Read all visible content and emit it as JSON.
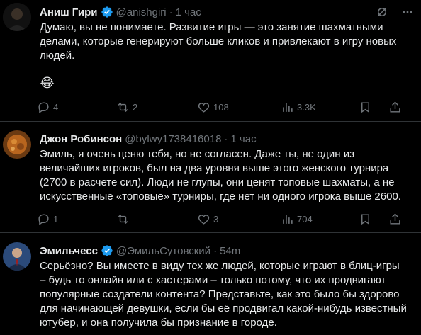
{
  "tweets": [
    {
      "name": "Аниш Гири",
      "handle": "@anishgiri",
      "time": "1 час",
      "text": "Думаю, вы не понимаете. Развитие игры — это занятие шахматными делами, которые генерируют больше кликов и привлекают в игру новых людей.",
      "emoji": "😂",
      "replies": "4",
      "reposts": "2",
      "likes": "108",
      "views": "3.3K"
    },
    {
      "name": "Джон Робинсон",
      "handle": "@bylwy1738416018",
      "time": "1 час",
      "text": "Эмиль, я очень ценю тебя, но не согласен. Даже ты, не один из величайших игроков, был на два уровня выше этого женского турнира (2700 в расчете сил). Люди не глупы, они ценят топовые шахматы, а не искусственные «топовые» турниры, где нет ни одного игрока выше 2600.",
      "replies": "1",
      "reposts": "",
      "likes": "3",
      "views": "704"
    },
    {
      "name": "Эмильчесс",
      "handle": "@ЭмильСутовский",
      "time": "54m",
      "text": "Серьёзно? Вы имеете в виду тех же людей, которые играют в блиц-игры – будь то онлайн или с хастерами – только потому, что их продвигают популярные создатели контента? Представьте, как это было бы здорово для начинающей девушки, если бы её продвигал какой-нибудь известный ютубер, и она получила бы признание в городе."
    }
  ],
  "colors": {
    "background": "#000000",
    "text": "#e7e9ea",
    "muted": "#71767b",
    "verified": "#1d9bf0",
    "divider": "#2f3336"
  }
}
